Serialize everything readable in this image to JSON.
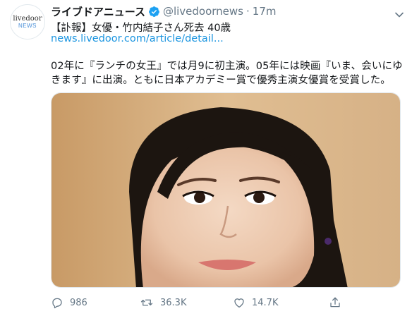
{
  "account": {
    "avatar_line1": "livedoor",
    "avatar_line2": "NEWS",
    "display_name": "ライブドアニュース",
    "handle": "@livedoornews",
    "separator": "·",
    "time": "17m"
  },
  "tweet": {
    "headline": "【訃報】女優・竹内結子さん死去 40歳",
    "link": "news.livedoor.com/article/detail...",
    "body": "02年に『ランチの女王』では月9に初主演。05年には映画『いま、会いにゆきます』に出演。ともに日本アカデミー賞で優秀主演女優賞を受賞した。"
  },
  "actions": {
    "reply_count": "986",
    "retweet_count": "36.3K",
    "like_count": "14.7K"
  },
  "icons": [
    "verified-icon",
    "chevron-down-icon",
    "reply-icon",
    "retweet-icon",
    "like-icon",
    "share-icon"
  ],
  "colors": {
    "link": "#1b95e0",
    "muted": "#657786",
    "verified": "#1da1f2"
  }
}
